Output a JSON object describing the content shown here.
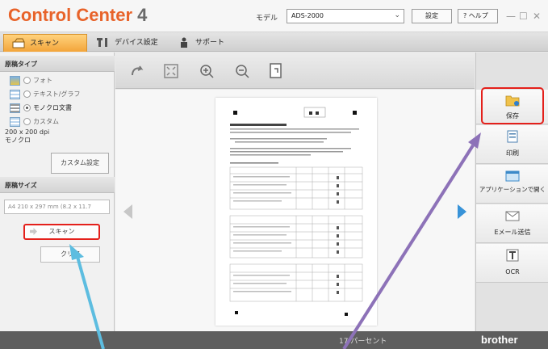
{
  "app": {
    "title_main": "Control Center",
    "title_num": "4",
    "accent": "#e8632a"
  },
  "model": {
    "label": "モデル",
    "value": "ADS-2000"
  },
  "titlebar": {
    "settings_label": "設定",
    "help_label": "?  ヘルプ",
    "minimize": "—",
    "maximize": "☐",
    "close": "✕"
  },
  "tabs": [
    {
      "label": "スキャン",
      "icon": "scan-tab-icon"
    },
    {
      "label": "デバイス設定",
      "icon": "tools-icon"
    },
    {
      "label": "サポート",
      "icon": "person-icon"
    }
  ],
  "doc_type": {
    "header": "原稿タイプ",
    "options": [
      {
        "label": "フォト",
        "selected": false
      },
      {
        "label": "テキスト/グラフ",
        "selected": false
      },
      {
        "label": "モノクロ文書",
        "selected": true
      },
      {
        "label": "カスタム",
        "selected": false
      }
    ],
    "dpi": "200 x 200 dpi",
    "color_mode": "モノクロ",
    "custom_button": "カスタム設定"
  },
  "doc_size": {
    "header": "原稿サイズ",
    "value": "A4 210 x 297 mm (8.2 x 11.7"
  },
  "buttons": {
    "scan": "スキャン",
    "clear": "クリア"
  },
  "toolbar": {
    "tools": [
      "rotate-icon",
      "fit-icon",
      "zoom-in-icon",
      "zoom-out-icon",
      "edit-page-icon"
    ]
  },
  "actions": [
    {
      "label": "保存",
      "icon": "folder-save-icon"
    },
    {
      "label": "印刷",
      "icon": "printer-icon"
    },
    {
      "label": "アプリケーションで開く",
      "icon": "app-icon"
    },
    {
      "label": "Eメール送信",
      "icon": "email-icon"
    },
    {
      "label": "OCR",
      "icon": "ocr-icon"
    }
  ],
  "status": {
    "text": "17 パーセント",
    "brand": "brother"
  }
}
